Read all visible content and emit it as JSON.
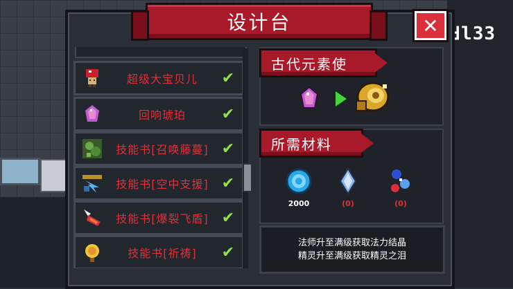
{
  "title": "设计台",
  "close_label": "✕",
  "hud_counter": "ꓤl33",
  "list": {
    "items": [
      {
        "name": "超级大宝贝儿",
        "icon": "mushroom-pet-icon",
        "checked": true
      },
      {
        "name": "回响琥珀",
        "icon": "amber-gem-icon",
        "checked": true
      },
      {
        "name": "技能书[召唤藤蔓]",
        "icon": "vine-skill-book-icon",
        "checked": true
      },
      {
        "name": "技能书[空中支援]",
        "icon": "air-support-skill-book-icon",
        "checked": true
      },
      {
        "name": "技能书[爆裂飞盾]",
        "icon": "burst-shield-skill-book-icon",
        "checked": true
      },
      {
        "name": "技能书[祈祷]",
        "icon": "prayer-skill-book-icon",
        "checked": true
      }
    ],
    "check_glyph": "✔"
  },
  "recipe": {
    "heading": "古代元素使",
    "input_icon": "amber-gem-icon",
    "arrow_icon": "green-arrow-icon",
    "output_icon": "elemental-golden-helm-icon"
  },
  "materials": {
    "heading": "所需材料",
    "items": [
      {
        "icon": "blue-gem-coin-icon",
        "qty": "2000",
        "qty_color": "#ffffff"
      },
      {
        "icon": "magic-crystal-icon",
        "qty": "(0)",
        "qty_color": "#e0303a"
      },
      {
        "icon": "spirit-tear-icon",
        "qty": "(0)",
        "qty_color": "#e0303a"
      }
    ]
  },
  "description": {
    "line1": "法师升至满级获取法力结晶",
    "line2": "精灵升至满级获取精灵之泪"
  },
  "colors": {
    "banner_red": "#a8192a",
    "item_text_red": "#e0303a",
    "check_green": "#8fe04a",
    "close_red": "#d9303c"
  }
}
